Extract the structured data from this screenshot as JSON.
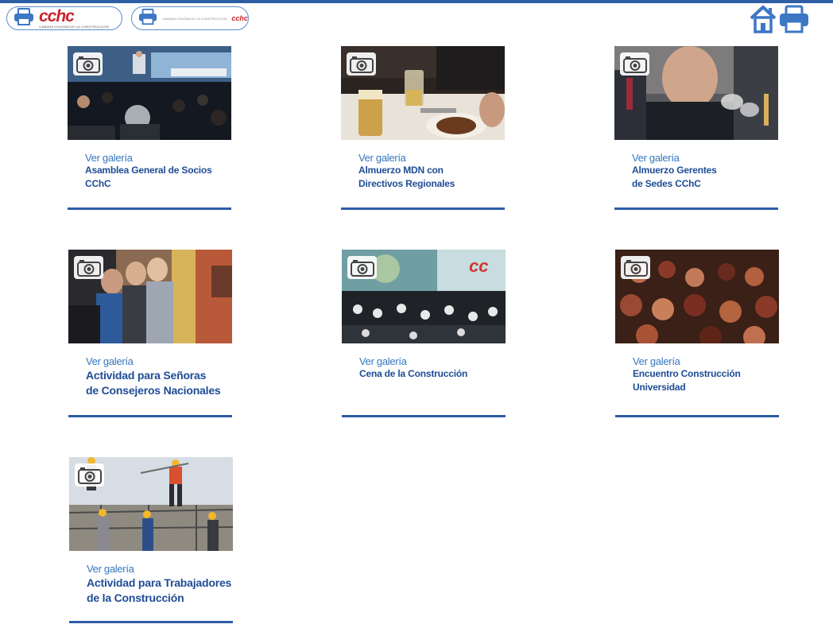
{
  "header": {
    "brand_logo": "cchc",
    "brand_sub": "CAMARA CHILENA DE LA CONSTRUCCION",
    "tab2_logo": "cchc",
    "tab2_sub": "CAMARA CHILENA DE LA CONSTRUCCION",
    "icons": [
      "printer-icon",
      "home-icon"
    ]
  },
  "colors": {
    "accent": "#2e5ea3",
    "link": "#3576be",
    "title": "#1e4c95",
    "brand_red": "#c8242b"
  },
  "galleries": [
    {
      "link": "Ver galería",
      "title": "Asamblea General de Socios\nCChC",
      "large": false,
      "photo": "assembly-photo"
    },
    {
      "link": "Ver galería",
      "title": "Almuerzo MDN con\nDirectivos Regionales",
      "large": false,
      "photo": "lunch-photo"
    },
    {
      "link": "Ver galería",
      "title": "Almuerzo Gerentes\nde Sedes CChC",
      "large": false,
      "photo": "managers-photo"
    },
    {
      "link": "Ver galería",
      "title": "Actividad para Señoras\nde Consejeros Nacionales",
      "large": true,
      "photo": "ladies-photo"
    },
    {
      "link": "Ver galería",
      "title": "Cena de la Construcción",
      "large": false,
      "photo": "dinner-photo"
    },
    {
      "link": "Ver galería",
      "title": "Encuentro Construcción\nUniversidad",
      "large": false,
      "photo": "university-photo"
    },
    {
      "link": "Ver galería",
      "title": "Actividad para Trabajadores\nde la Construcción",
      "large": true,
      "photo": "workers-photo"
    }
  ]
}
